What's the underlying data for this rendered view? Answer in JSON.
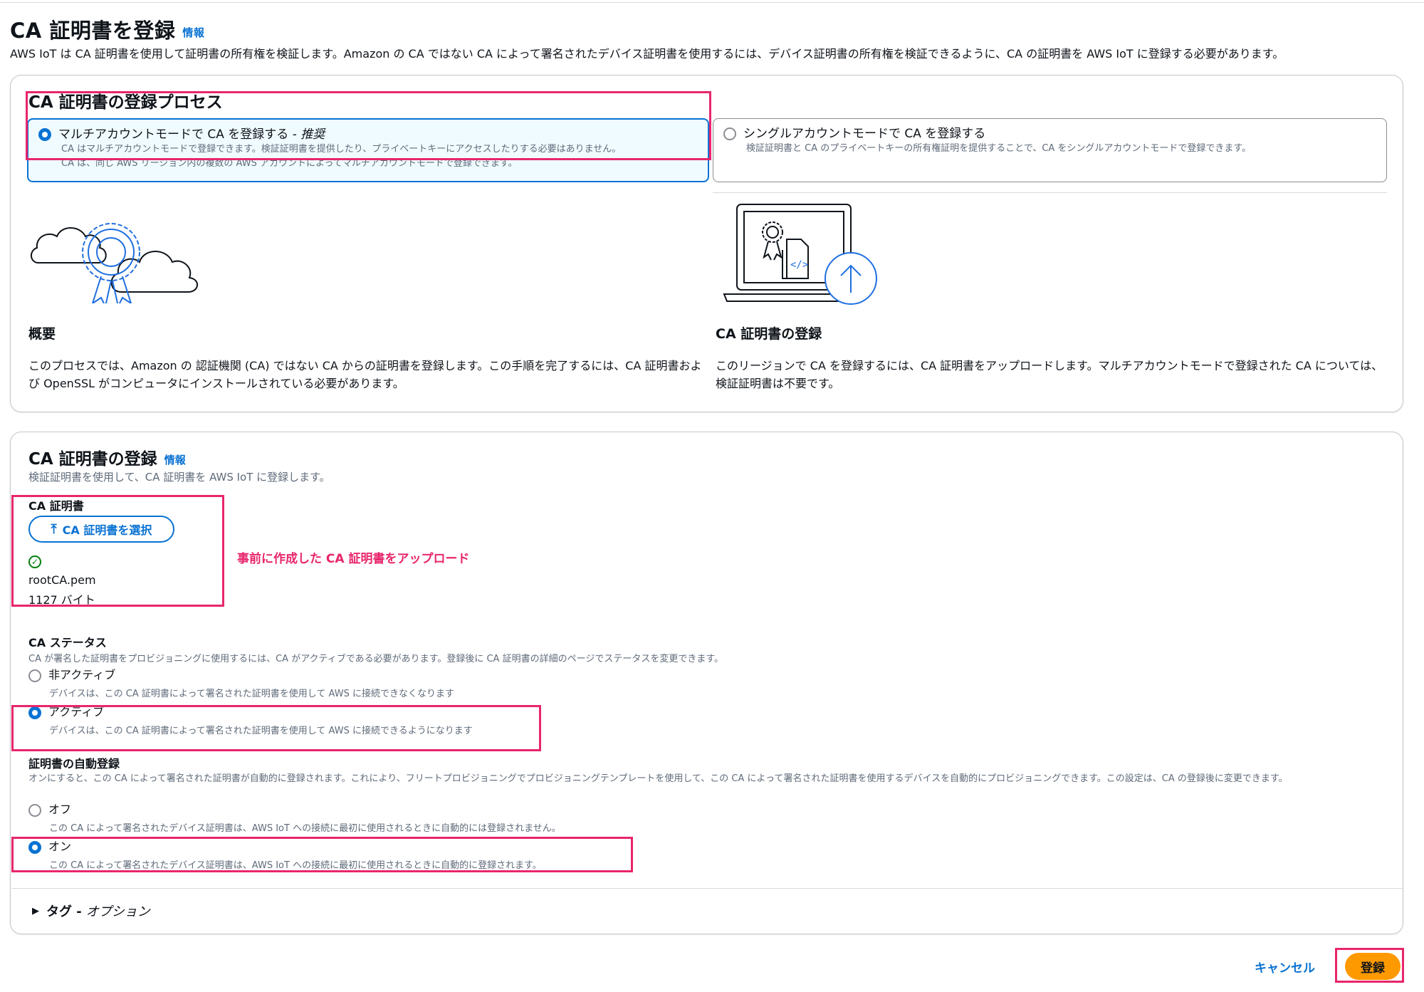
{
  "page": {
    "title": "CA 証明書を登録",
    "info": "情報",
    "description": "AWS IoT は CA 証明書を使用して証明書の所有権を検証します。Amazon の CA ではない CA によって署名されたデバイス証明書を使用するには、デバイス証明書の所有権を検証できるように、CA の証明書を AWS IoT に登録する必要があります。"
  },
  "process": {
    "title": "CA 証明書の登録プロセス",
    "multi": {
      "label": "マルチアカウントモードで CA を登録する - ",
      "label_em": "推奨",
      "desc1": "CA はマルチアカウントモードで登録できます。検証証明書を提供したり、プライベートキーにアクセスしたりする必要はありません。",
      "desc2": "CA は、同じ AWS リージョン内の複数の AWS アカウントによってマルチアカウントモードで登録できます。",
      "selected": true
    },
    "single": {
      "label": "シングルアカウントモードで CA を登録する",
      "desc": "検証証明書と CA のプライベートキーの所有権証明を提供することで、CA をシングルアカウントモードで登録できます。",
      "selected": false
    },
    "overview": {
      "heading": "概要",
      "body": "このプロセスでは、Amazon の 認証機関 (CA) ではない CA からの証明書を登録します。この手順を完了するには、CA 証明書および OpenSSL がコンピュータにインストールされている必要があります。"
    },
    "register": {
      "heading": "CA 証明書の登録",
      "body": "このリージョンで CA を登録するには、CA 証明書をアップロードします。マルチアカウントモードで登録された CA については、検証証明書は不要です。"
    }
  },
  "register": {
    "title": "CA 証明書の登録",
    "info": "情報",
    "description": "検証証明書を使用して、CA 証明書を AWS IoT に登録します。",
    "ca_label": "CA 証明書",
    "upload_button": "CA 証明書を選択",
    "file_name": "rootCA.pem",
    "file_size": "1127 バイト",
    "annotation": "事前に作成した CA 証明書をアップロード",
    "status": {
      "label": "CA ステータス",
      "desc": "CA が署名した証明書をプロビジョニングに使用するには、CA がアクティブである必要があります。登録後に CA 証明書の詳細のページでステータスを変更できます。",
      "inactive_label": "非アクティブ",
      "inactive_desc": "デバイスは、この CA 証明書によって署名された証明書を使用して AWS に接続できなくなります",
      "active_label": "アクティブ",
      "active_desc": "デバイスは、この CA 証明書によって署名された証明書を使用して AWS に接続できるようになります",
      "selected": "active"
    },
    "auto": {
      "label": "証明書の自動登録",
      "desc": "オンにすると、この CA によって署名された証明書が自動的に登録されます。これにより、フリートプロビジョニングでプロビジョニングテンプレートを使用して、この CA によって署名された証明書を使用するデバイスを自動的にプロビジョニングできます。この設定は、CA の登録後に変更できます。",
      "off_label": "オフ",
      "off_desc": "この CA によって署名されたデバイス証明書は、AWS IoT への接続に最初に使用されるときに自動的には登録されません。",
      "on_label": "オン",
      "on_desc": "この CA によって署名されたデバイス証明書は、AWS IoT への接続に最初に使用されるときに自動的に登録されます。",
      "selected": "on"
    },
    "tags_label": "タグ - ",
    "tags_optional": "オプション"
  },
  "footer": {
    "cancel": "キャンセル",
    "submit": "登録"
  },
  "colors": {
    "accent": "#0972d3",
    "highlight": "#e8266c",
    "primary_button": "#ff9900",
    "success": "#037f0c"
  },
  "icons": [
    "cloud-certificate-illustration",
    "laptop-upload-illustration",
    "upload-icon",
    "check-circle-icon",
    "caret-right-icon"
  ]
}
